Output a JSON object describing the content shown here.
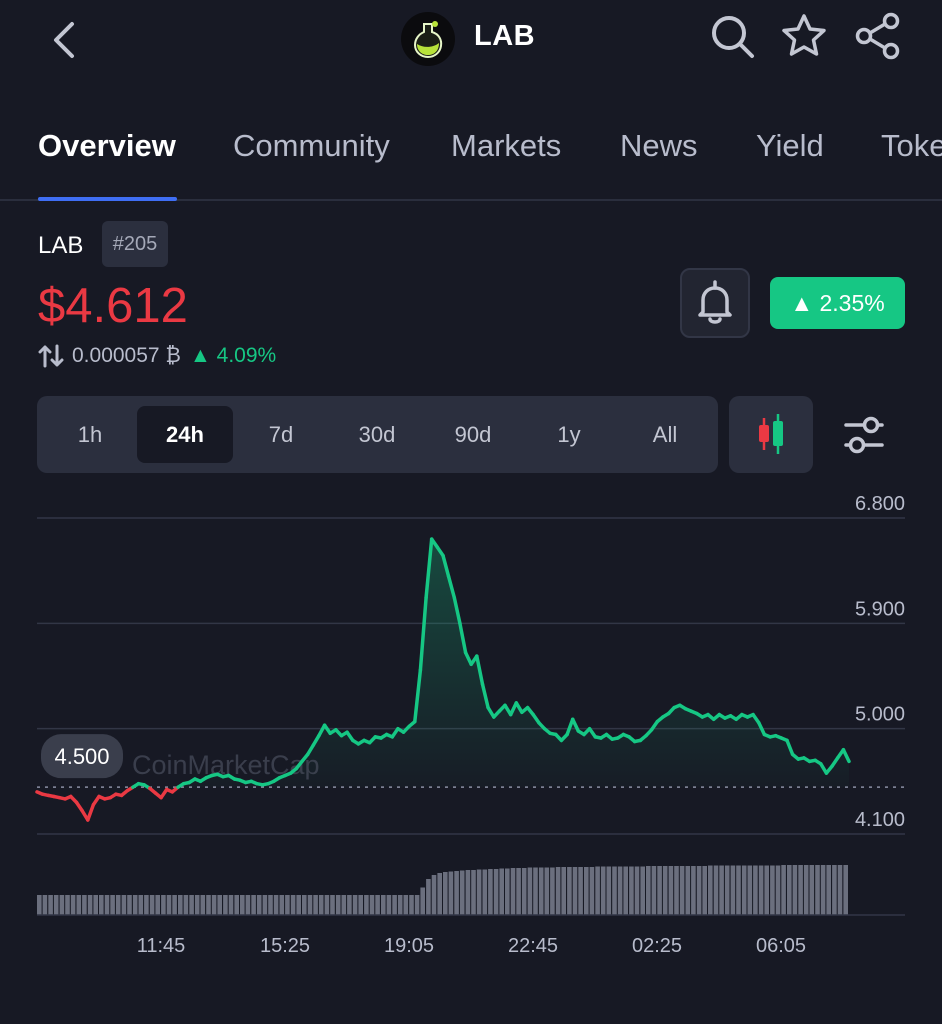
{
  "header": {
    "title": "LAB",
    "icons": [
      "back-arrow-icon",
      "coin-logo",
      "search-icon",
      "star-icon",
      "share-icon"
    ]
  },
  "tabs": [
    {
      "label": "Overview",
      "active": true
    },
    {
      "label": "Community"
    },
    {
      "label": "Markets"
    },
    {
      "label": "News"
    },
    {
      "label": "Yield"
    },
    {
      "label": "Toke"
    }
  ],
  "coin": {
    "symbol": "LAB",
    "rank": "#205",
    "price": "$4.612",
    "btc_price": "0.000057 ₿",
    "btc_change": "4.09%",
    "change_24h": "2.35%"
  },
  "ranges": {
    "options": [
      "1h",
      "24h",
      "7d",
      "30d",
      "90d",
      "1y",
      "All"
    ],
    "selected": "24h"
  },
  "colors": {
    "background": "#171924",
    "up": "#16c784",
    "down": "#ea3943",
    "accent": "#3f6ef4"
  },
  "chart_data": {
    "type": "line",
    "title": "",
    "xlabel": "",
    "ylabel": "",
    "x_ticks": [
      "11:45",
      "15:25",
      "19:05",
      "22:45",
      "02:25",
      "06:05"
    ],
    "y_ticks": [
      "6.800",
      "5.900",
      "5.000",
      "4.100"
    ],
    "ylim": [
      4.1,
      6.8
    ],
    "baseline": 4.5,
    "baseline_label": "4.500",
    "watermark": "CoinMarketCap",
    "price_series": [
      4.46,
      4.44,
      4.43,
      4.42,
      4.41,
      4.4,
      4.42,
      4.37,
      4.3,
      4.22,
      4.35,
      4.42,
      4.4,
      4.41,
      4.44,
      4.43,
      4.47,
      4.5,
      4.53,
      4.52,
      4.49,
      4.45,
      4.41,
      4.48,
      4.46,
      4.5,
      4.53,
      4.54,
      4.57,
      4.55,
      4.58,
      4.6,
      4.61,
      4.59,
      4.6,
      4.57,
      4.56,
      4.54,
      4.55,
      4.53,
      4.52,
      4.53,
      4.55,
      4.58,
      4.6,
      4.62,
      4.66,
      4.72,
      4.78,
      4.86,
      4.94,
      5.03,
      4.96,
      4.99,
      4.94,
      4.97,
      4.9,
      4.87,
      4.9,
      4.88,
      4.93,
      4.92,
      4.95,
      4.93,
      5.0,
      4.97,
      5.02,
      5.06,
      5.5,
      6.12,
      6.62,
      6.55,
      6.48,
      6.3,
      6.12,
      5.9,
      5.65,
      5.55,
      5.62,
      5.38,
      5.18,
      5.1,
      5.15,
      5.2,
      5.12,
      5.22,
      5.14,
      5.18,
      5.12,
      5.05,
      5.0,
      4.96,
      4.95,
      4.9,
      4.95,
      5.08,
      4.98,
      4.95,
      5.0,
      4.93,
      4.92,
      4.95,
      4.91,
      4.92,
      4.95,
      4.93,
      4.89,
      4.9,
      4.94,
      4.99,
      5.06,
      5.1,
      5.13,
      5.18,
      5.2,
      5.17,
      5.15,
      5.13,
      5.1,
      5.12,
      5.08,
      5.12,
      5.09,
      5.11,
      5.08,
      5.12,
      5.1,
      5.12,
      5.05,
      4.95,
      4.93,
      4.94,
      4.92,
      4.9,
      4.78,
      4.74,
      4.75,
      4.72,
      4.73,
      4.7,
      4.62,
      4.68,
      4.75,
      4.82,
      4.72
    ],
    "volume_series": [
      0.4,
      0.4,
      0.4,
      0.4,
      0.4,
      0.4,
      0.4,
      0.4,
      0.4,
      0.4,
      0.4,
      0.4,
      0.4,
      0.4,
      0.4,
      0.4,
      0.4,
      0.4,
      0.4,
      0.4,
      0.4,
      0.4,
      0.4,
      0.4,
      0.4,
      0.4,
      0.4,
      0.4,
      0.4,
      0.4,
      0.4,
      0.4,
      0.4,
      0.4,
      0.4,
      0.4,
      0.4,
      0.4,
      0.4,
      0.4,
      0.4,
      0.4,
      0.4,
      0.4,
      0.4,
      0.4,
      0.4,
      0.4,
      0.4,
      0.4,
      0.4,
      0.4,
      0.4,
      0.4,
      0.4,
      0.4,
      0.4,
      0.4,
      0.4,
      0.4,
      0.4,
      0.4,
      0.4,
      0.4,
      0.4,
      0.4,
      0.4,
      0.4,
      0.55,
      0.72,
      0.8,
      0.84,
      0.86,
      0.87,
      0.88,
      0.89,
      0.9,
      0.9,
      0.91,
      0.91,
      0.92,
      0.92,
      0.93,
      0.93,
      0.94,
      0.94,
      0.94,
      0.95,
      0.95,
      0.95,
      0.95,
      0.95,
      0.96,
      0.96,
      0.96,
      0.96,
      0.96,
      0.96,
      0.96,
      0.97,
      0.97,
      0.97,
      0.97,
      0.97,
      0.97,
      0.97,
      0.97,
      0.97,
      0.98,
      0.98,
      0.98,
      0.98,
      0.98,
      0.98,
      0.98,
      0.98,
      0.98,
      0.98,
      0.98,
      0.99,
      0.99,
      0.99,
      0.99,
      0.99,
      0.99,
      0.99,
      0.99,
      0.99,
      0.99,
      0.99,
      0.99,
      0.99,
      1,
      1,
      1,
      1,
      1,
      1,
      1,
      1,
      1,
      1,
      1,
      1
    ]
  }
}
